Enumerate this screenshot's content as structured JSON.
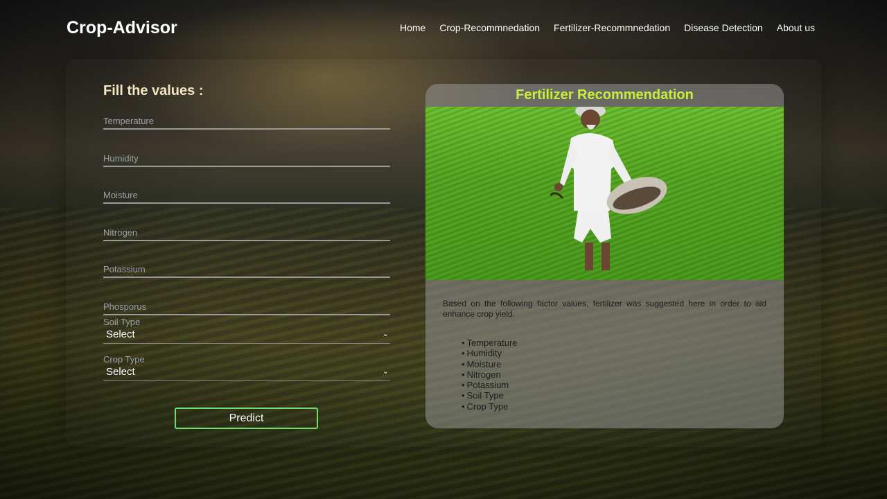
{
  "header": {
    "brand": "Crop-Advisor",
    "nav": [
      "Home",
      "Crop-Recommnedation",
      "Fertilizer-Recommnedation",
      "Disease Detection",
      "About us"
    ]
  },
  "form": {
    "title": "Fill the values :",
    "fields": [
      {
        "placeholder": "Temperature",
        "value": ""
      },
      {
        "placeholder": "Humidity",
        "value": ""
      },
      {
        "placeholder": "Moisture",
        "value": ""
      },
      {
        "placeholder": "Nitrogen",
        "value": ""
      },
      {
        "placeholder": "Potassium",
        "value": ""
      },
      {
        "placeholder": "Phosporus",
        "value": ""
      }
    ],
    "soil_type": {
      "label": "Soil Type",
      "selected": "Select"
    },
    "crop_type": {
      "label": "Crop Type",
      "selected": "Select"
    },
    "submit_label": "Predict"
  },
  "card": {
    "title": "Fertilizer Recommendation",
    "image_icon": "farmer-spreading-fertilizer-photo",
    "description": "Based on the following factor values, fertilizer was suggested here in order to aid enhance crop yield.",
    "factors": [
      "Temperature",
      "Humidity",
      "Moisture",
      "Nitrogen",
      "Potassium",
      "Soil Type",
      "Crop Type"
    ]
  },
  "colors": {
    "card_title": "#c6ef3a",
    "form_title": "#f3e6c2",
    "button_border": "#6fdc6f"
  }
}
